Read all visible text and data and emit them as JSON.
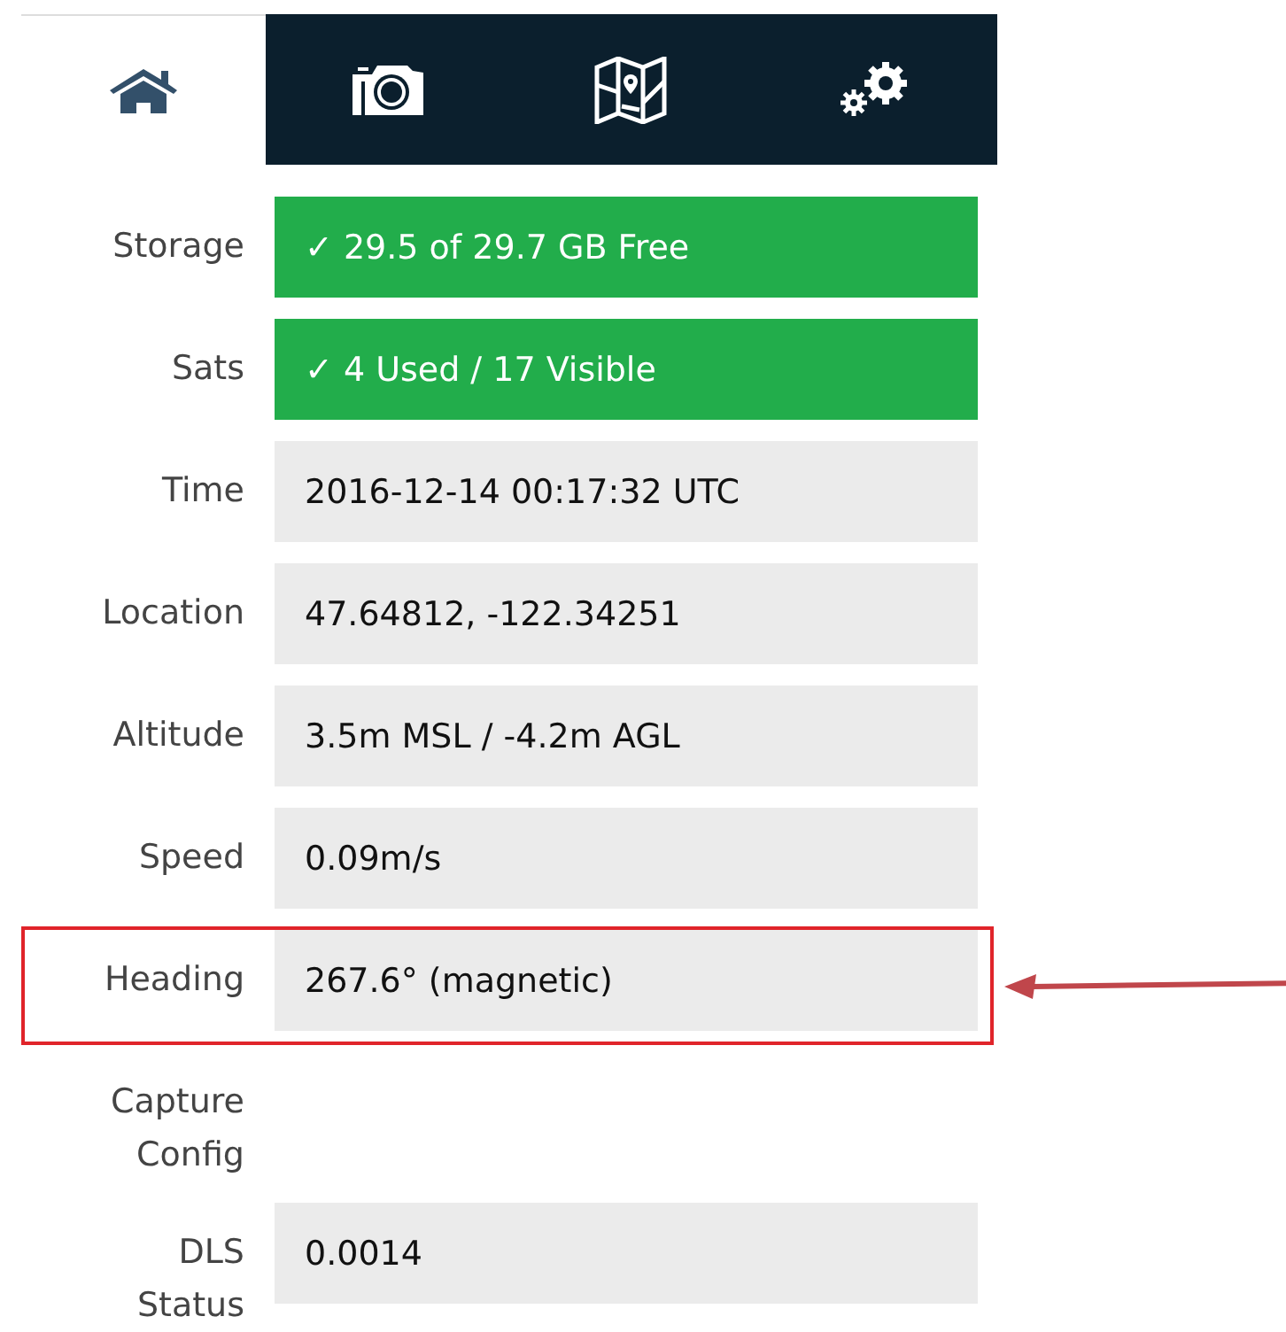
{
  "tabs": [
    {
      "kind": "home",
      "selected": true
    },
    {
      "kind": "camera",
      "selected": false
    },
    {
      "kind": "map",
      "selected": false
    },
    {
      "kind": "settings",
      "selected": false
    }
  ],
  "rows": [
    {
      "label": "Storage",
      "kind": "ok",
      "value": "✓ 29.5 of 29.7 GB Free",
      "highlighted": false
    },
    {
      "label": "Sats",
      "kind": "ok",
      "value": "✓ 4 Used / 17 Visible",
      "highlighted": false
    },
    {
      "label": "Time",
      "kind": "info",
      "value": "2016-12-14 00:17:32 UTC",
      "highlighted": false
    },
    {
      "label": "Location",
      "kind": "info",
      "value": "47.64812, -122.34251",
      "highlighted": false
    },
    {
      "label": "Altitude",
      "kind": "info",
      "value": "3.5m MSL / -4.2m AGL",
      "highlighted": false
    },
    {
      "label": "Speed",
      "kind": "info",
      "value": "0.09m/s",
      "highlighted": false
    },
    {
      "label": "Heading",
      "kind": "info",
      "value": "267.6° (magnetic)",
      "highlighted": true
    },
    {
      "label": "Capture Config",
      "kind": "empty",
      "highlighted": false
    },
    {
      "label": "DLS Status",
      "kind": "info",
      "value": "0.0014",
      "highlighted": false
    }
  ]
}
